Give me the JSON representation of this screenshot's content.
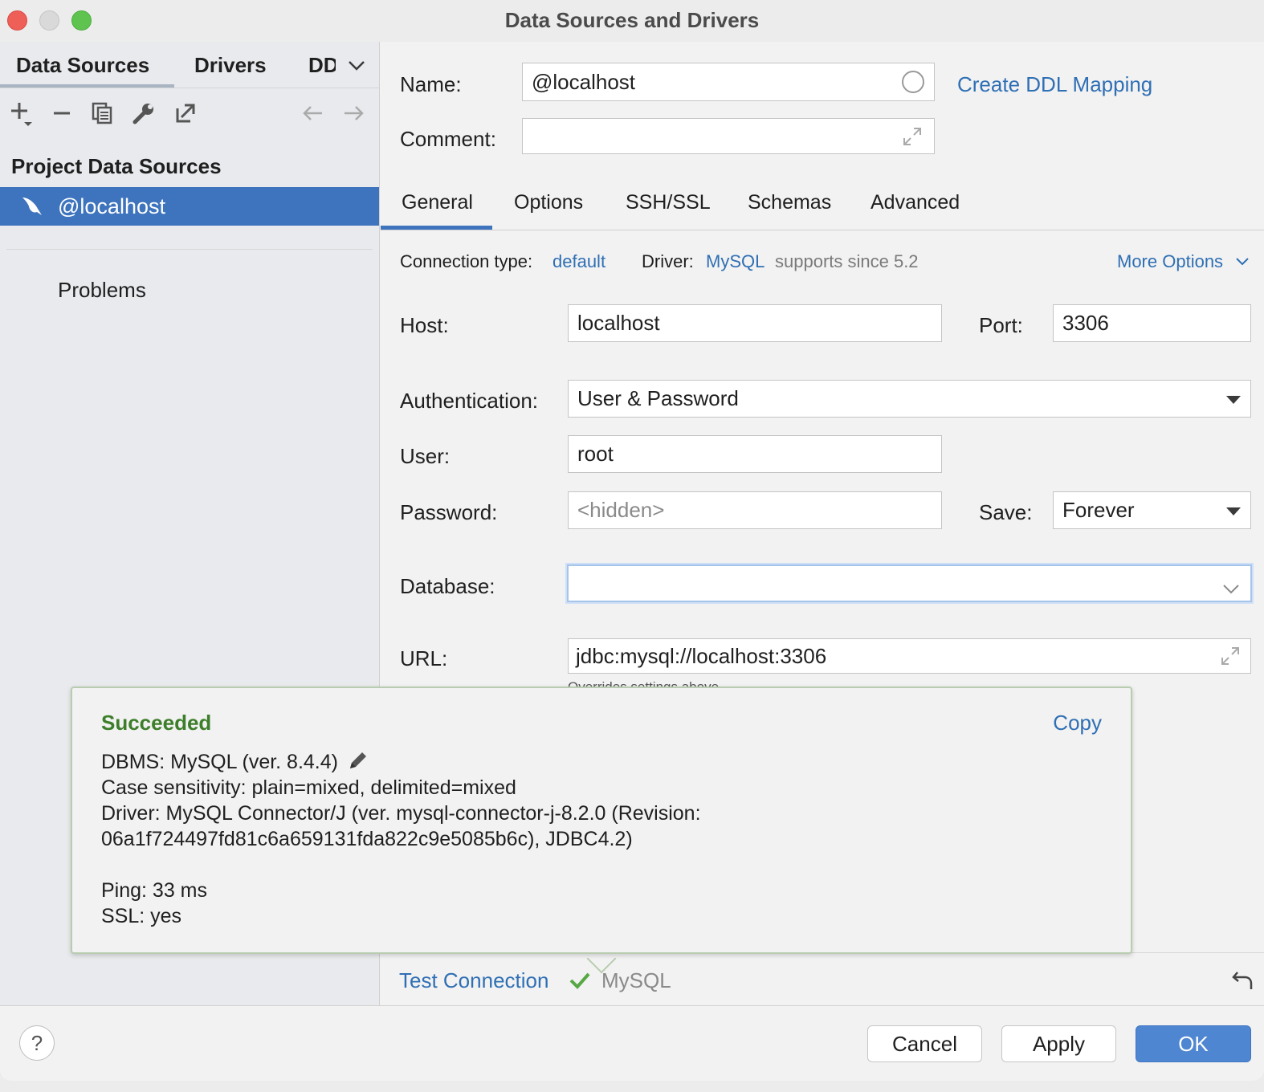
{
  "window": {
    "title": "Data Sources and Drivers"
  },
  "left": {
    "tabs": [
      "Data Sources",
      "Drivers",
      "DD"
    ],
    "section_title": "Project Data Sources",
    "selected_item": "@localhost",
    "problems_label": "Problems"
  },
  "form": {
    "name_label": "Name:",
    "name_value": "@localhost",
    "create_ddl_link": "Create DDL Mapping",
    "comment_label": "Comment:",
    "comment_value": "",
    "tabs": [
      "General",
      "Options",
      "SSH/SSL",
      "Schemas",
      "Advanced"
    ],
    "connection_type_label": "Connection type:",
    "connection_type_value": "default",
    "driver_label": "Driver:",
    "driver_value": "MySQL",
    "driver_note": "supports since 5.2",
    "more_options": "More Options",
    "host_label": "Host:",
    "host_value": "localhost",
    "port_label": "Port:",
    "port_value": "3306",
    "auth_label": "Authentication:",
    "auth_value": "User & Password",
    "user_label": "User:",
    "user_value": "root",
    "password_label": "Password:",
    "password_placeholder": "<hidden>",
    "save_label": "Save:",
    "save_value": "Forever",
    "database_label": "Database:",
    "database_value": "",
    "url_label": "URL:",
    "url_value": "jdbc:mysql://localhost:3306",
    "url_note": "Overrides settings above"
  },
  "popup": {
    "title": "Succeeded",
    "copy": "Copy",
    "dbms": "DBMS: MySQL (ver. 8.4.4)",
    "case": "Case sensitivity: plain=mixed, delimited=mixed",
    "driver1": "Driver: MySQL Connector/J (ver. mysql-connector-j-8.2.0 (Revision:",
    "driver2": "06a1f724497fd81c6a659131fda822c9e5085b6c), JDBC4.2)",
    "ping": "Ping: 33 ms",
    "ssl": "SSL: yes"
  },
  "footer": {
    "test_connection": "Test Connection",
    "driver_name": "MySQL",
    "help": "?",
    "cancel": "Cancel",
    "apply": "Apply",
    "ok": "OK"
  },
  "colors": {
    "accent": "#3d74bd",
    "link": "#2f6fb4",
    "success": "#3c7e2a",
    "ok_button": "#4f86d1"
  }
}
